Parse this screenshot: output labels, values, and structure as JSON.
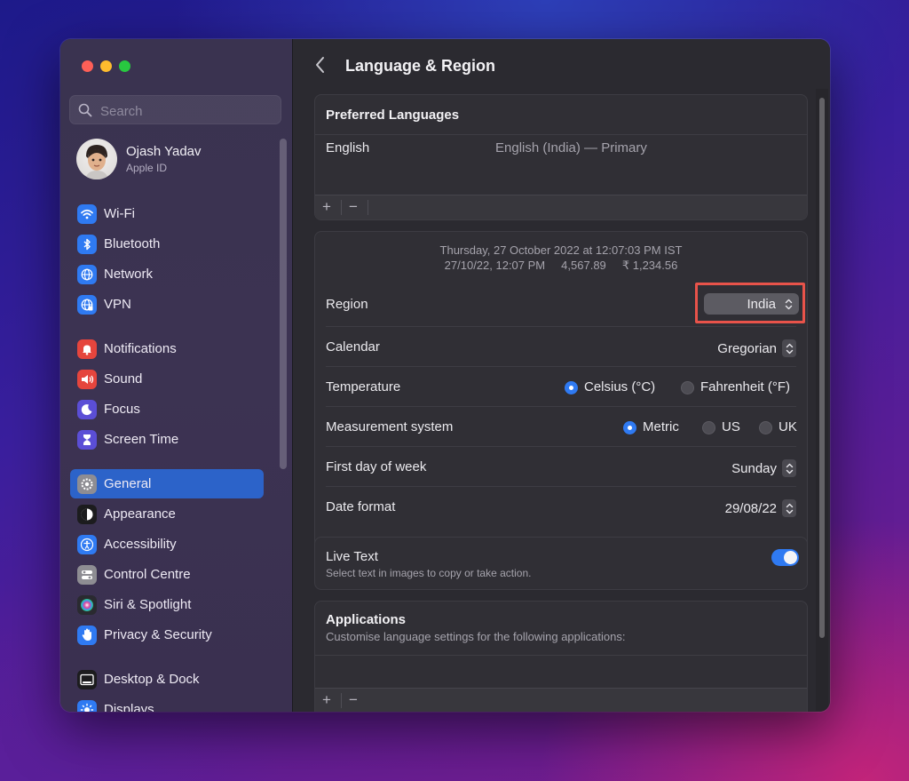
{
  "sidebar": {
    "search_placeholder": "Search",
    "profile": {
      "name": "Ojash Yadav",
      "subtitle": "Apple ID"
    },
    "items": [
      {
        "label": "Wi-Fi",
        "icon": "wifi-icon",
        "color": "#2f7af2"
      },
      {
        "label": "Bluetooth",
        "icon": "bluetooth-icon",
        "color": "#2f7af2"
      },
      {
        "label": "Network",
        "icon": "globe-icon",
        "color": "#2f7af2"
      },
      {
        "label": "VPN",
        "icon": "vpn-globe-icon",
        "color": "#2f7af2"
      },
      {
        "label": "Notifications",
        "icon": "bell-icon",
        "color": "#e5453d"
      },
      {
        "label": "Sound",
        "icon": "speaker-icon",
        "color": "#e5453d"
      },
      {
        "label": "Focus",
        "icon": "moon-icon",
        "color": "#5b4ed6"
      },
      {
        "label": "Screen Time",
        "icon": "hourglass-icon",
        "color": "#5b4ed6"
      },
      {
        "label": "General",
        "icon": "gear-icon",
        "color": "#8e8d93",
        "active": true
      },
      {
        "label": "Appearance",
        "icon": "appearance-icon",
        "color": "#1c1c1e"
      },
      {
        "label": "Accessibility",
        "icon": "accessibility-icon",
        "color": "#2f7af2"
      },
      {
        "label": "Control Centre",
        "icon": "control-centre-icon",
        "color": "#8e8d93"
      },
      {
        "label": "Siri & Spotlight",
        "icon": "siri-icon",
        "color": "#2a2a30"
      },
      {
        "label": "Privacy & Security",
        "icon": "hand-icon",
        "color": "#2f7af2"
      },
      {
        "label": "Desktop & Dock",
        "icon": "dock-icon",
        "color": "#1c1c1e"
      },
      {
        "label": "Displays",
        "icon": "sun-icon",
        "color": "#2f7af2"
      }
    ]
  },
  "main": {
    "title": "Language & Region",
    "preferred": {
      "heading": "Preferred Languages",
      "language": "English",
      "language_detail": "English (India) — Primary",
      "add": "+",
      "remove": "−"
    },
    "format_preview": {
      "line1": "Thursday, 27 October 2022 at 12:07:03 PM IST",
      "line2": "27/10/22, 12:07 PM     4,567.89     ₹ 1,234.56"
    },
    "region": {
      "label": "Region",
      "value": "India"
    },
    "calendar": {
      "label": "Calendar",
      "value": "Gregorian"
    },
    "temperature": {
      "label": "Temperature",
      "options": [
        "Celsius (°C)",
        "Fahrenheit (°F)"
      ],
      "selected": "Celsius (°C)"
    },
    "measurement": {
      "label": "Measurement system",
      "options": [
        "Metric",
        "US",
        "UK"
      ],
      "selected": "Metric"
    },
    "first_day": {
      "label": "First day of week",
      "value": "Sunday"
    },
    "date_format": {
      "label": "Date format",
      "value": "29/08/22"
    },
    "live_text": {
      "label": "Live Text",
      "description": "Select text in images to copy or take action.",
      "enabled": true
    },
    "applications": {
      "heading": "Applications",
      "description": "Customise language settings for the following applications:",
      "add": "+",
      "remove": "−"
    }
  },
  "colors": {
    "accent": "#2f7af2",
    "highlight": "#e8534a"
  }
}
